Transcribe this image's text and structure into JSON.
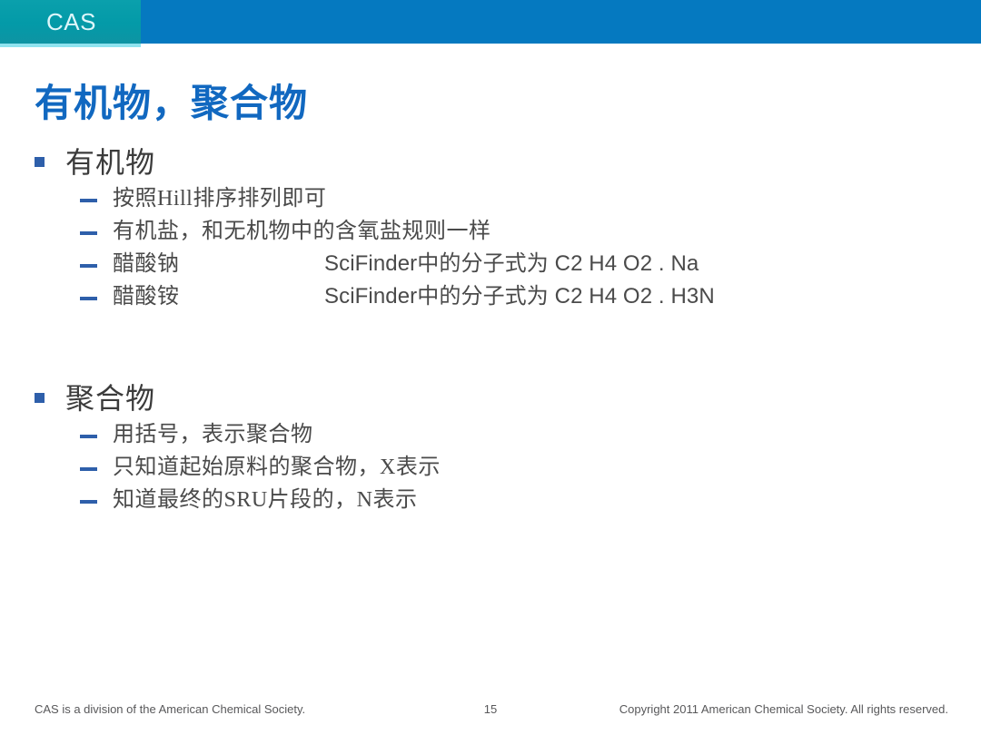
{
  "header": {
    "logo_text": "CAS",
    "teal_color": "#039aa8",
    "blue_color": "#0579c0",
    "accent_underline_color": "#8fe3ef"
  },
  "title": {
    "text": "有机物，聚合物",
    "color": "#1168c0"
  },
  "bullet_colors": {
    "square": "#2e5faa",
    "dash": "#2e5faa"
  },
  "sections": [
    {
      "heading": "有机物",
      "items": [
        {
          "label": "按照Hill排序排列即可",
          "formula": ""
        },
        {
          "label": "有机盐，和无机物中的含氧盐规则一样",
          "formula": ""
        },
        {
          "label": "醋酸钠",
          "formula": "SciFinder中的分子式为 C2 H4 O2 . Na"
        },
        {
          "label": "醋酸铵",
          "formula": "SciFinder中的分子式为 C2 H4 O2 . H3N"
        }
      ]
    },
    {
      "heading": "聚合物",
      "items": [
        {
          "label": "用括号，表示聚合物",
          "formula": ""
        },
        {
          "label": "只知道起始原料的聚合物，X表示",
          "formula": ""
        },
        {
          "label": "知道最终的SRU片段的，N表示",
          "formula": ""
        }
      ]
    }
  ],
  "footer": {
    "left": "CAS is a division of the American Chemical Society.",
    "page_number": "15",
    "right": "Copyright 2011 American Chemical Society. All rights reserved."
  }
}
